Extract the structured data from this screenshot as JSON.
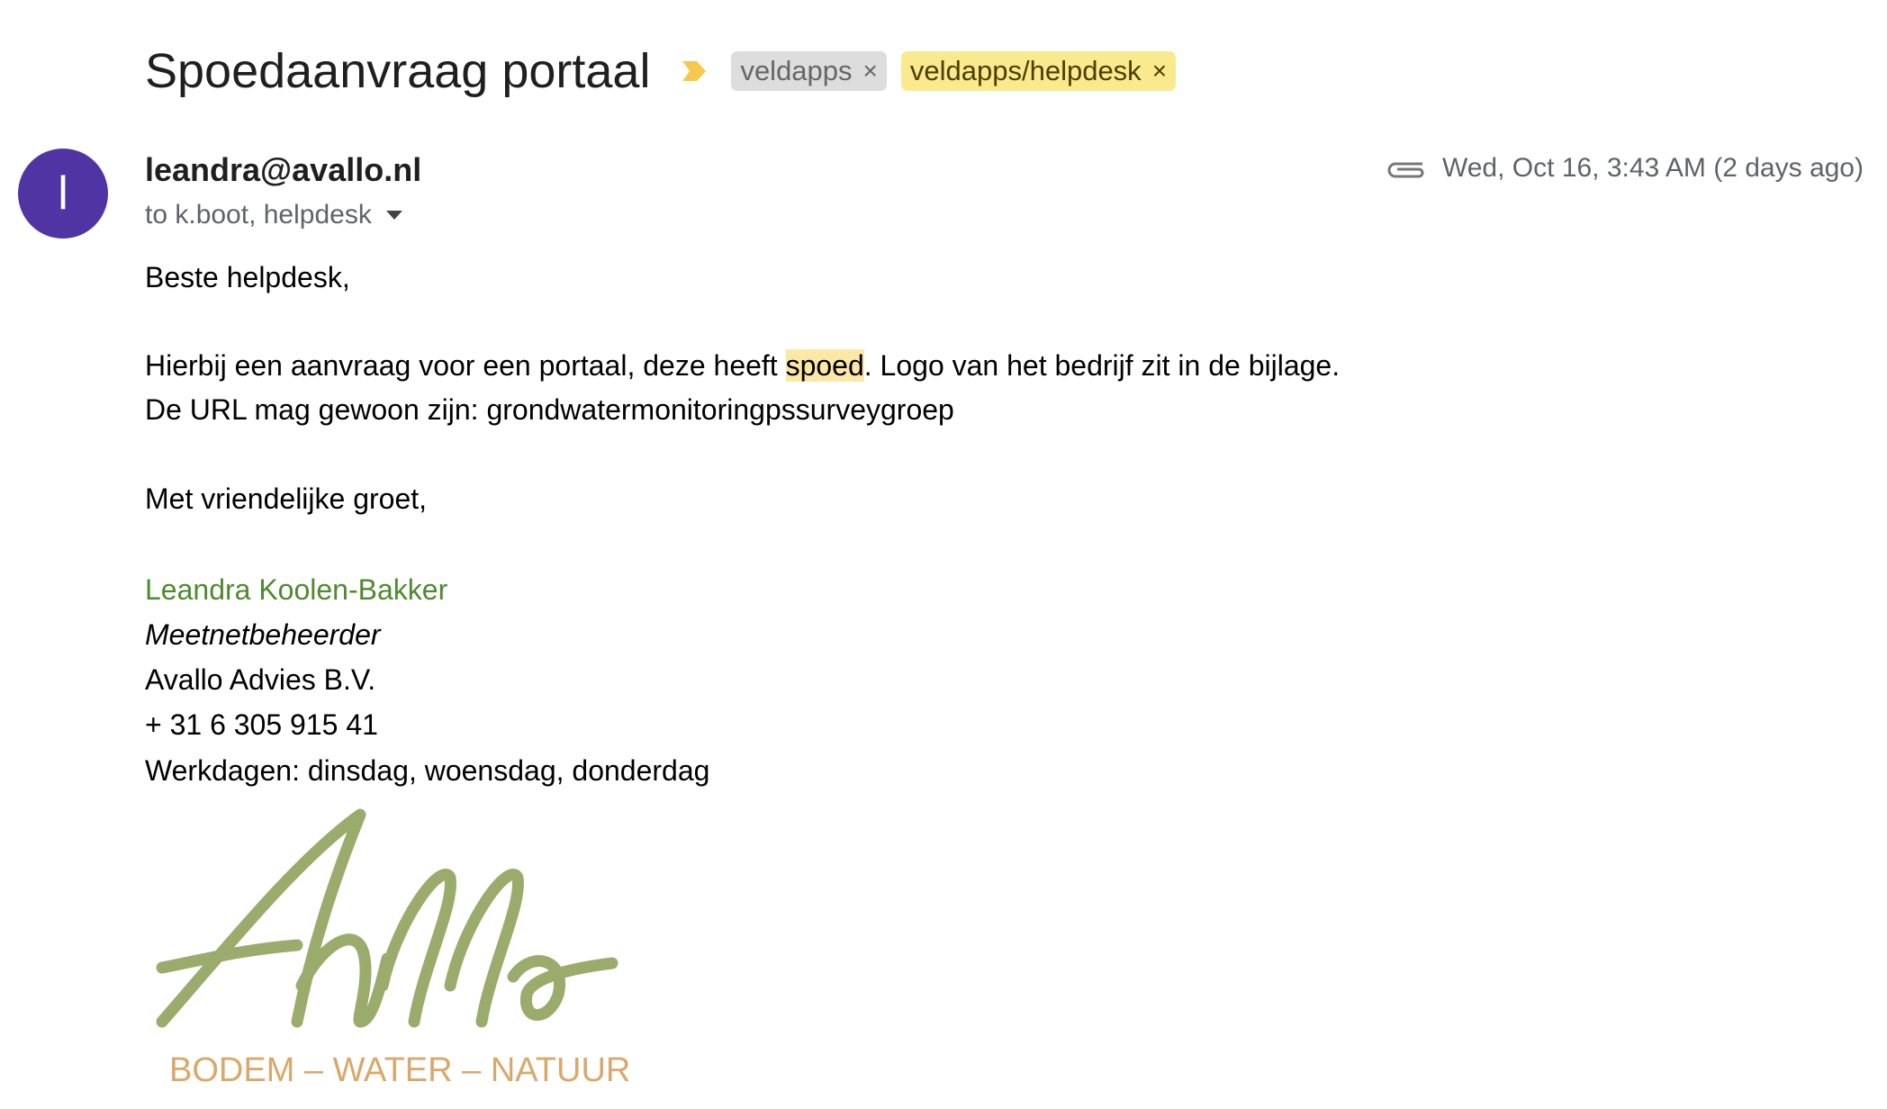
{
  "email": {
    "subject": "Spoedaanvraag portaal",
    "labels": [
      {
        "text": "veldapps",
        "remove": "×"
      },
      {
        "text": "veldapps/helpdesk",
        "remove": "×"
      }
    ],
    "avatar_letter": "l",
    "sender": "leandra@avallo.nl",
    "recipients": "to k.boot, helpdesk",
    "date": "Wed, Oct 16, 3:43 AM (2 days ago)",
    "body": {
      "greeting": "Beste helpdesk,",
      "line1_pre": "Hierbij een aanvraag voor een portaal, deze heeft ",
      "line1_highlight": "spoed",
      "line1_post": ". Logo van het bedrijf zit in de bijlage.",
      "line2": "De URL mag gewoon zijn: grondwatermonitoringpssurveygroep",
      "closing": "Met vriendelijke groet,"
    },
    "signature": {
      "name": "Leandra Koolen-Bakker",
      "role": "Meetnetbeheerder",
      "company": "Avallo Advies B.V.",
      "phone": "+ 31 6 305 915 41",
      "workdays": "Werkdagen: dinsdag, woensdag, donderdag",
      "logo_wordmark": "Avallo",
      "logo_tagline": "BODEM – WATER – NATUUR"
    }
  },
  "colors": {
    "avatar": "#5134a4",
    "label_yellow": "#fbe98e",
    "label_gray": "#dddddd",
    "logo_green": "#9aab6b",
    "logo_tan": "#d9a86a"
  }
}
